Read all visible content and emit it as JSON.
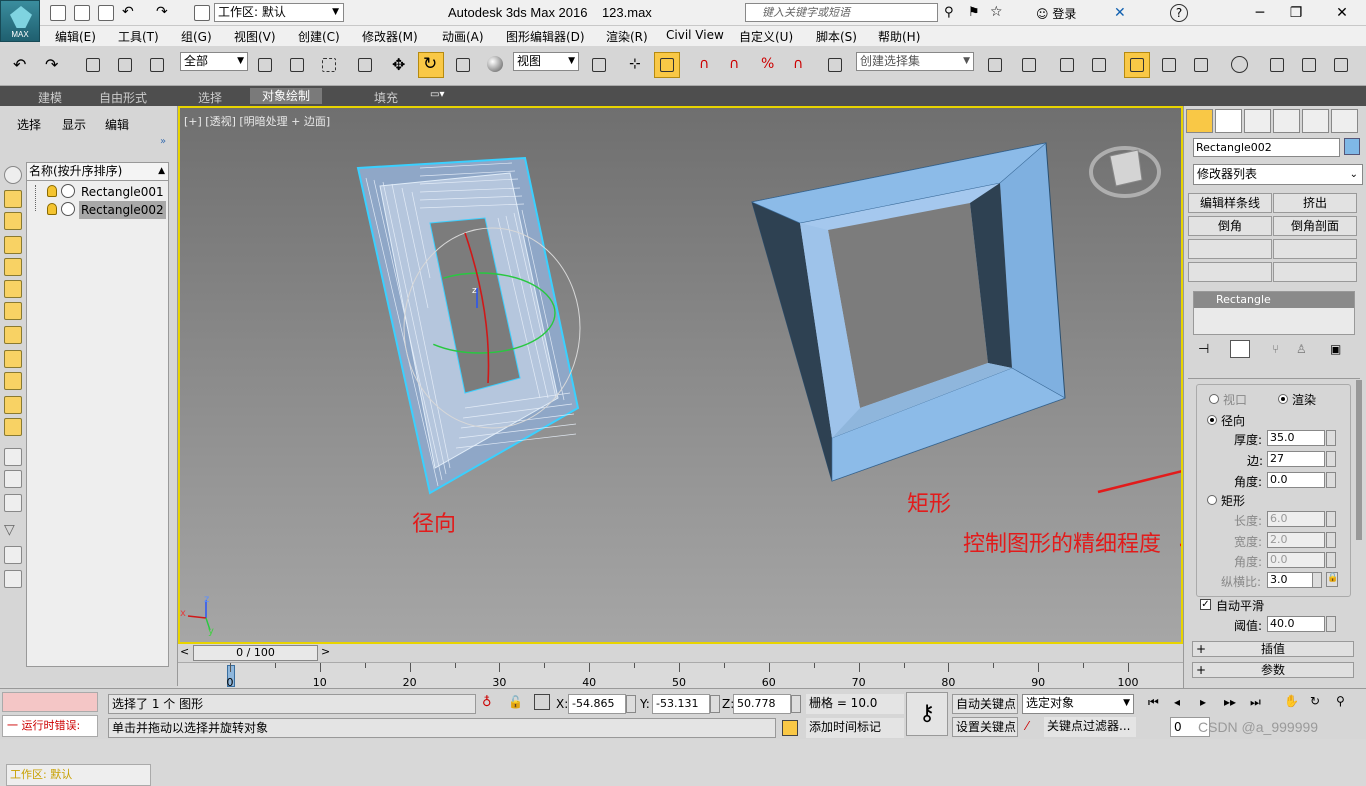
{
  "title_bar": {
    "workspace_label": "工作区: 默认",
    "app_title": "Autodesk 3ds Max 2016",
    "file_name": "123.max",
    "search_placeholder": "键入关键字或短语",
    "login": "登录",
    "logo_text": "MAX"
  },
  "menu": [
    "编辑(E)",
    "工具(T)",
    "组(G)",
    "视图(V)",
    "创建(C)",
    "修改器(M)",
    "动画(A)",
    "图形编辑器(D)",
    "渲染(R)",
    "Civil View",
    "自定义(U)",
    "脚本(S)",
    "帮助(H)"
  ],
  "toolbar": {
    "selection_filter": "全部",
    "ref_coord": "视图",
    "named_selection": "创建选择集"
  },
  "ribbon": {
    "tabs": [
      "建模",
      "自由形式",
      "选择",
      "对象绘制",
      "填充"
    ],
    "active_tab": "对象绘制"
  },
  "scene_explorer": {
    "tabs": [
      "选择",
      "显示",
      "编辑"
    ],
    "column_header": "名称(按升序排序)",
    "objects": [
      "Rectangle001",
      "Rectangle002"
    ],
    "selected_object": "Rectangle002",
    "workspace_status": "工作区: 默认"
  },
  "viewport": {
    "label": "[+] [透视] [明暗处理 + 边面]",
    "annotations": {
      "left_shape": "径向",
      "right_shape": "矩形",
      "arrow_note": "控制图形的精细程度"
    },
    "axis_labels": {
      "x": "x",
      "y": "y",
      "z": "z"
    }
  },
  "command_panel": {
    "object_name": "Rectangle002",
    "modifier_list": "修改器列表",
    "buttons": [
      "编辑样条线",
      "挤出",
      "倒角",
      "倒角剖面"
    ],
    "stack_item": "Rectangle",
    "rendering": {
      "viewport_label": "视口",
      "render_label": "渲染",
      "render_selected": true,
      "radial_label": "径向",
      "radial_selected": true,
      "thickness_label": "厚度:",
      "thickness": "35.0",
      "sides_label": "边:",
      "sides": "27",
      "angle_label": "角度:",
      "angle": "0.0",
      "rect_label": "矩形",
      "length_label": "长度:",
      "length": "6.0",
      "width_label": "宽度:",
      "width": "2.0",
      "rect_angle_label": "角度:",
      "rect_angle": "0.0",
      "aspect_label": "纵横比:",
      "aspect": "3.0",
      "auto_smooth_label": "自动平滑",
      "auto_smooth": true,
      "threshold_label": "阈值:",
      "threshold": "40.0"
    },
    "rollouts": [
      "插值",
      "参数"
    ]
  },
  "timeline": {
    "frame": "0 / 100",
    "ticks": [
      "0",
      "10",
      "20",
      "30",
      "40",
      "50",
      "60",
      "70",
      "80",
      "90",
      "100"
    ]
  },
  "status_bar": {
    "selection_info": "选择了 1 个 图形",
    "prompt": "单击并拖动以选择并旋转对象",
    "script_error": "一 运行时错误:",
    "x_label": "X:",
    "x": "-54.865",
    "y_label": "Y:",
    "y": "-53.131",
    "z_label": "Z:",
    "z": "50.778",
    "grid": "栅格 = 10.0",
    "auto_key": "自动关键点",
    "set_key": "设置关键点",
    "selected_object": "选定对象",
    "key_filters": "关键点过滤器...",
    "add_time_tag": "添加时间标记",
    "frame_field": "0",
    "watermark": "CSDN @a_999999"
  },
  "colors": {
    "selection_highlight": "#f9c846",
    "viewport_border": "#e8d400",
    "annotation": "#e21b1b",
    "shape_blue": "#7fb0e0"
  }
}
